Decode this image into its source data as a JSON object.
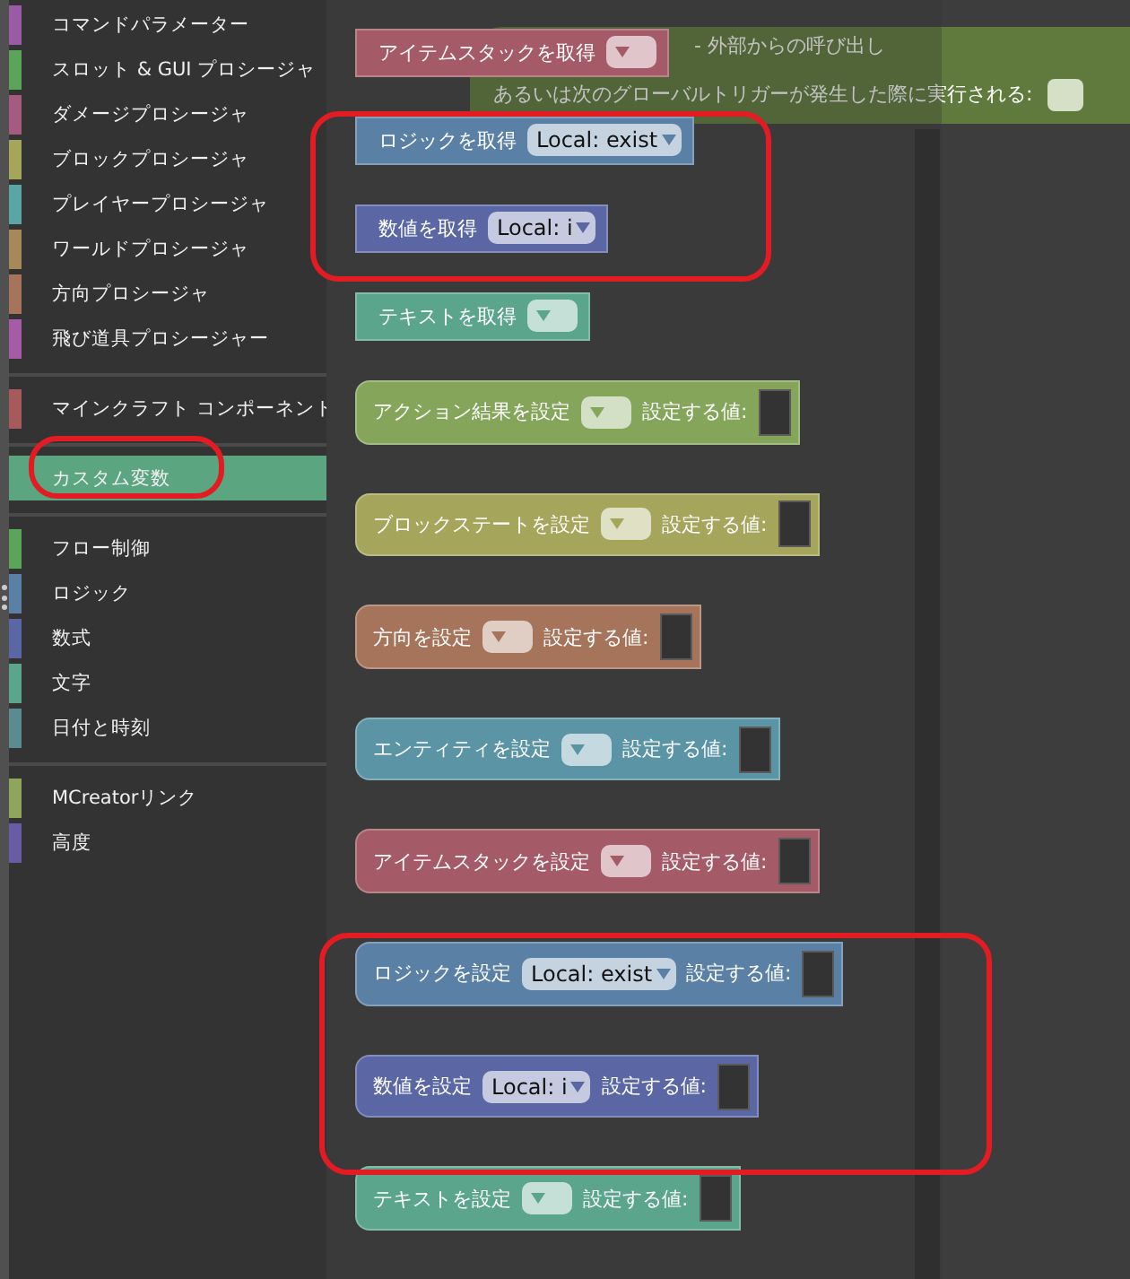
{
  "sidebar": {
    "groups": [
      {
        "items": [
          {
            "label": "コマンドパラメーター",
            "color": "#995ba5",
            "selected": false
          },
          {
            "label": "スロット & GUI プロシージャ",
            "color": "#5ba55b",
            "selected": false
          },
          {
            "label": "ダメージプロシージャ",
            "color": "#a55b80",
            "selected": false
          },
          {
            "label": "ブロックプロシージャ",
            "color": "#a5a55b",
            "selected": false
          },
          {
            "label": "プレイヤープロシージャ",
            "color": "#5ba5a5",
            "selected": false
          },
          {
            "label": "ワールドプロシージャ",
            "color": "#a5895b",
            "selected": false
          },
          {
            "label": "方向プロシージャ",
            "color": "#a5745b",
            "selected": false
          },
          {
            "label": "飛び道具プロシージャー",
            "color": "#a55ba5",
            "selected": false
          }
        ]
      },
      {
        "items": [
          {
            "label": "マインクラフト コンポーネント",
            "color": "#a55b5b",
            "selected": false
          }
        ]
      },
      {
        "items": [
          {
            "label": "カスタム変数",
            "color": "#5ba580",
            "selected": true
          }
        ]
      },
      {
        "items": [
          {
            "label": "フロー制御",
            "color": "#5ba55b",
            "selected": false
          },
          {
            "label": "ロジック",
            "color": "#5b80a5",
            "selected": false
          },
          {
            "label": "数式",
            "color": "#5b67a5",
            "selected": false
          },
          {
            "label": "文字",
            "color": "#5ba58c",
            "selected": false
          },
          {
            "label": "日付と時刻",
            "color": "#5b8a8f",
            "selected": false
          }
        ]
      },
      {
        "items": [
          {
            "label": "MCreatorリンク",
            "color": "#8fa55b",
            "selected": false
          },
          {
            "label": "高度",
            "color": "#6a5ba5",
            "selected": false
          }
        ]
      }
    ]
  },
  "workspace_block": {
    "line_1": "- 外部からの呼び出し",
    "line_2": "あるいは次のグローバルトリガーが発生した際に実行される:"
  },
  "flyout": {
    "blocks": [
      {
        "kind": "getter",
        "label": "アイテムスタックを取得",
        "color": "#a55b67"
      },
      {
        "kind": "getter",
        "label": "ロジックを取得",
        "dropdown": "Local: exist",
        "color": "#5b80a5"
      },
      {
        "kind": "getter",
        "label": "数値を取得",
        "dropdown": "Local: i",
        "color": "#5b67a5"
      },
      {
        "kind": "getter",
        "label": "テキストを取得",
        "color": "#5ba58c"
      },
      {
        "kind": "setter",
        "label": "アクション結果を設定",
        "value_label": "設定する値:",
        "color": "#85a55b"
      },
      {
        "kind": "setter",
        "label": "ブロックステートを設定",
        "value_label": "設定する値:",
        "color": "#a5a55b"
      },
      {
        "kind": "setter",
        "label": "方向を設定",
        "value_label": "設定する値:",
        "color": "#a5745b"
      },
      {
        "kind": "setter",
        "label": "エンティティを設定",
        "value_label": "設定する値:",
        "color": "#5b95a5"
      },
      {
        "kind": "setter",
        "label": "アイテムスタックを設定",
        "value_label": "設定する値:",
        "color": "#a55b67"
      },
      {
        "kind": "setter",
        "label": "ロジックを設定",
        "dropdown": "Local: exist",
        "value_label": "設定する値:",
        "color": "#5b80a5"
      },
      {
        "kind": "setter",
        "label": "数値を設定",
        "dropdown": "Local: i",
        "value_label": "設定する値:",
        "color": "#5b67a5"
      },
      {
        "kind": "setter",
        "label": "テキストを設定",
        "value_label": "設定する値:",
        "color": "#5ba58c"
      }
    ]
  }
}
